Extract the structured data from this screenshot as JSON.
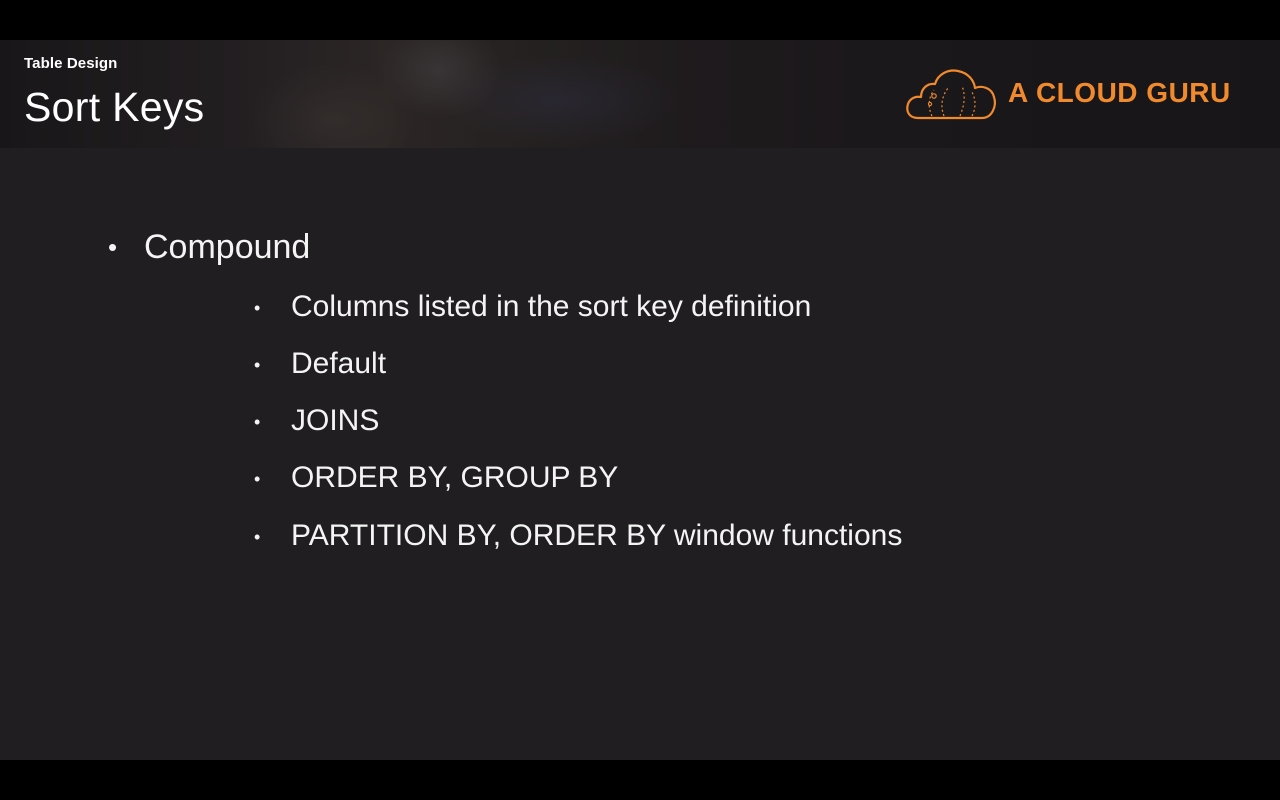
{
  "header": {
    "section_label": "Table Design",
    "title": "Sort Keys",
    "logo_text": "A CLOUD GURU",
    "logo_icon": "cloud-logo-icon",
    "accent_color": "#f08a2c"
  },
  "content": {
    "bullet_glyph": "•",
    "main_item": "Compound",
    "sub_items": [
      "Columns listed in the sort key definition",
      "Default",
      "JOINS",
      "ORDER BY, GROUP BY",
      "PARTITION BY, ORDER BY window functions"
    ]
  }
}
